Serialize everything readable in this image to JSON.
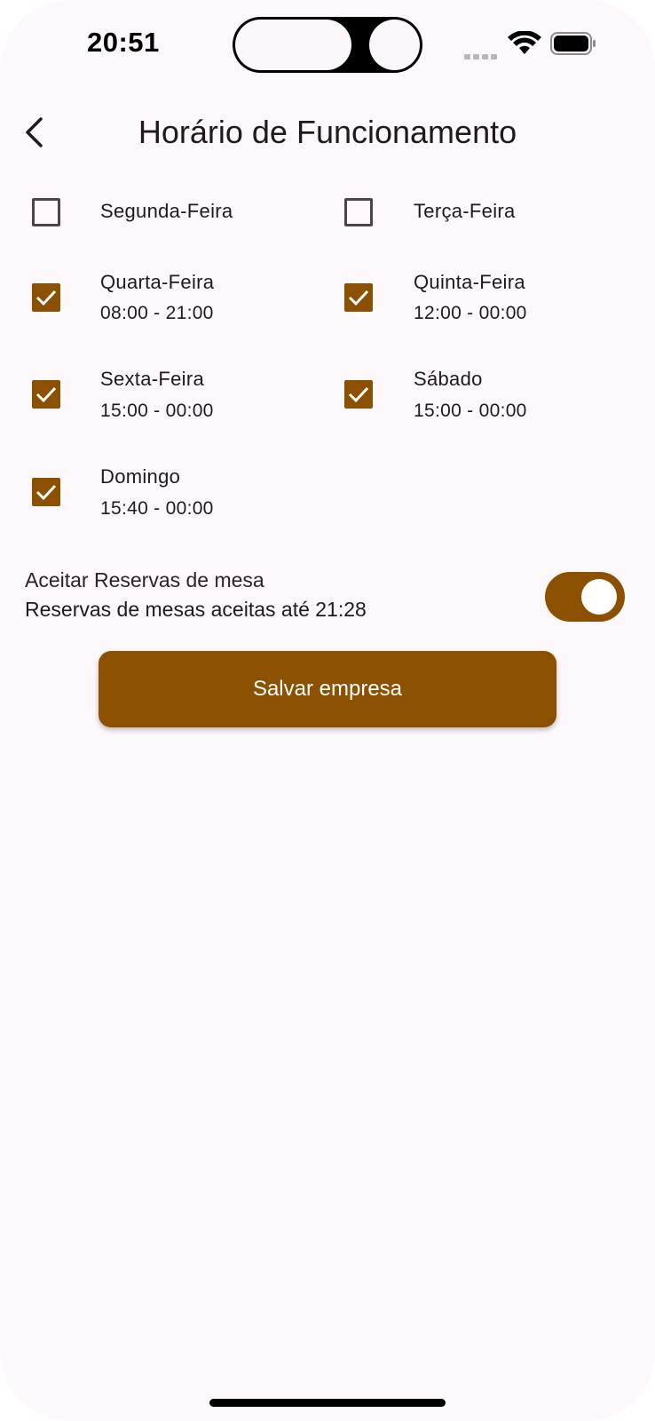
{
  "status_bar": {
    "time": "20:51"
  },
  "header": {
    "title": "Horário de Funcionamento",
    "back_icon": "chevron-left-icon"
  },
  "days": [
    {
      "name": "Segunda-Feira",
      "checked": false,
      "hours": ""
    },
    {
      "name": "Terça-Feira",
      "checked": false,
      "hours": ""
    },
    {
      "name": "Quarta-Feira",
      "checked": true,
      "hours": "08:00 - 21:00"
    },
    {
      "name": "Quinta-Feira",
      "checked": true,
      "hours": "12:00 - 00:00"
    },
    {
      "name": "Sexta-Feira",
      "checked": true,
      "hours": "15:00 - 00:00"
    },
    {
      "name": "Sábado",
      "checked": true,
      "hours": "15:00 - 00:00"
    },
    {
      "name": "Domingo",
      "checked": true,
      "hours": "15:40 - 00:00"
    }
  ],
  "reservations": {
    "label": "Aceitar Reservas de mesa",
    "subtitle": "Reservas de mesas aceitas até 21:28",
    "enabled": true
  },
  "actions": {
    "save_label": "Salvar empresa"
  },
  "colors": {
    "accent": "#8b5000",
    "background": "#fdf8fc",
    "text": "#1f1b1d"
  }
}
